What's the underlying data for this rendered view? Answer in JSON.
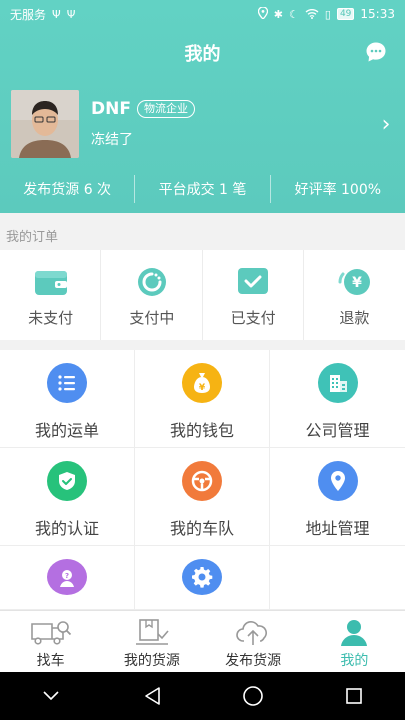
{
  "status_bar": {
    "carrier": "无服务",
    "time": "15:33",
    "battery": "49"
  },
  "header": {
    "title": "我的"
  },
  "profile": {
    "name": "DNF",
    "tag": "物流企业",
    "status": "冻结了"
  },
  "stats": [
    {
      "label": "发布货源 6 次"
    },
    {
      "label": "平台成交 1 笔"
    },
    {
      "label": "好评率 100%"
    }
  ],
  "orders": {
    "section_label": "我的订单",
    "items": [
      {
        "label": "未支付",
        "icon": "wallet-icon"
      },
      {
        "label": "支付中",
        "icon": "loading-icon"
      },
      {
        "label": "已支付",
        "icon": "check-icon"
      },
      {
        "label": "退款",
        "icon": "refund-icon"
      }
    ]
  },
  "grid": [
    {
      "label": "我的运单",
      "icon": "list-icon",
      "color": "#4f8ef0"
    },
    {
      "label": "我的钱包",
      "icon": "money-bag-icon",
      "color": "#f6b313"
    },
    {
      "label": "公司管理",
      "icon": "building-icon",
      "color": "#3fc2b7"
    },
    {
      "label": "我的认证",
      "icon": "shield-check-icon",
      "color": "#27c27b"
    },
    {
      "label": "我的车队",
      "icon": "steering-wheel-icon",
      "color": "#f17a3b"
    },
    {
      "label": "地址管理",
      "icon": "location-pin-icon",
      "color": "#4f8ef0"
    },
    {
      "label": "",
      "icon": "support-agent-icon",
      "color": "#b46fe1"
    },
    {
      "label": "",
      "icon": "gear-icon",
      "color": "#4f8ef0"
    },
    {
      "label": "",
      "icon": "",
      "color": ""
    }
  ],
  "tabs": [
    {
      "label": "找车",
      "icon": "truck-search-icon",
      "active": false
    },
    {
      "label": "我的货源",
      "icon": "cargo-icon",
      "active": false
    },
    {
      "label": "发布货源",
      "icon": "cloud-upload-icon",
      "active": false
    },
    {
      "label": "我的",
      "icon": "user-icon",
      "active": true
    }
  ],
  "colors": {
    "accent": "#5ccabd",
    "active_tab": "#3cbcae"
  }
}
